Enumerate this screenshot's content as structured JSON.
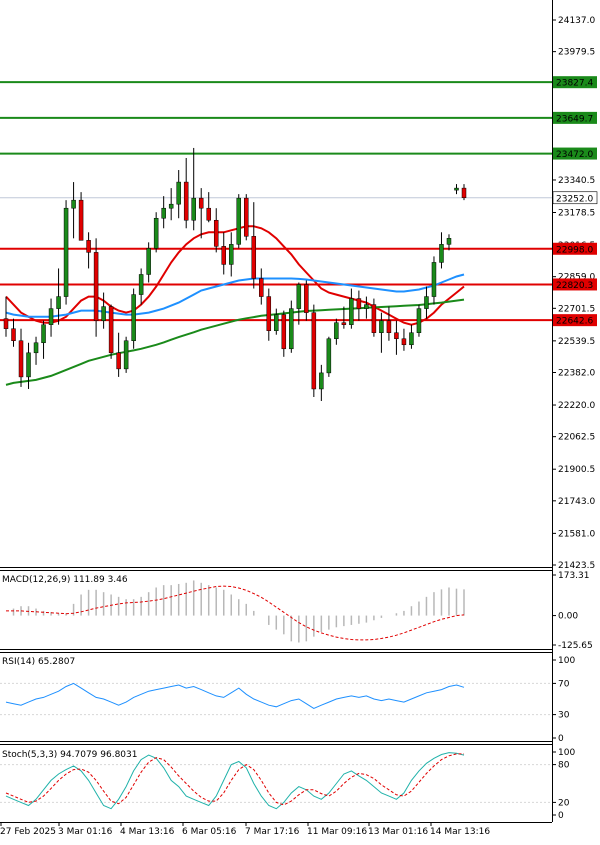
{
  "chart_data": {
    "type": "candlestick",
    "price_axis": {
      "ticks": [
        "24137.0",
        "23979.5",
        "23814.6",
        "23649.7",
        "23472.0",
        "23340.5",
        "23178.5",
        "23016.5",
        "22859.0",
        "22701.5",
        "22539.5",
        "22382.0",
        "22220.0",
        "22062.5",
        "21900.5",
        "21743.0",
        "21581.0",
        "21423.5"
      ],
      "range": [
        21423.5,
        24137.0
      ]
    },
    "time_axis": {
      "labels": [
        "27 Feb 2025",
        "3 Mar 01:16",
        "4 Mar 13:16",
        "6 Mar 05:16",
        "7 Mar 17:16",
        "11 Mar 09:16",
        "13 Mar 01:16",
        "14 Mar 13:16"
      ]
    },
    "levels": {
      "green": [
        {
          "value": 23827.4,
          "label": "23827.4"
        },
        {
          "value": 23649.7,
          "label": "23649.7"
        },
        {
          "value": 23472.0,
          "label": "23472.0"
        }
      ],
      "red": [
        {
          "value": 22998.0,
          "label": "22998.0"
        },
        {
          "value": 22820.3,
          "label": "22820.3"
        },
        {
          "value": 22642.6,
          "label": "22642.6"
        }
      ],
      "current": {
        "value": 23252.0,
        "label": "23252.0"
      }
    },
    "candles": [
      {
        "o": 22650,
        "h": 22760,
        "l": 22560,
        "c": 22600
      },
      {
        "o": 22600,
        "h": 22650,
        "l": 22510,
        "c": 22540
      },
      {
        "o": 22540,
        "h": 22600,
        "l": 22310,
        "c": 22360
      },
      {
        "o": 22360,
        "h": 22530,
        "l": 22300,
        "c": 22480
      },
      {
        "o": 22480,
        "h": 22560,
        "l": 22420,
        "c": 22530
      },
      {
        "o": 22530,
        "h": 22640,
        "l": 22450,
        "c": 22620
      },
      {
        "o": 22620,
        "h": 22750,
        "l": 22560,
        "c": 22700
      },
      {
        "o": 22700,
        "h": 22900,
        "l": 22620,
        "c": 22760
      },
      {
        "o": 22760,
        "h": 23240,
        "l": 22720,
        "c": 23200
      },
      {
        "o": 23200,
        "h": 23330,
        "l": 23050,
        "c": 23240
      },
      {
        "o": 23240,
        "h": 23280,
        "l": 23050,
        "c": 23040
      },
      {
        "o": 23040,
        "h": 23080,
        "l": 22900,
        "c": 22980
      },
      {
        "o": 22980,
        "h": 23050,
        "l": 22560,
        "c": 22640
      },
      {
        "o": 22640,
        "h": 22780,
        "l": 22600,
        "c": 22710
      },
      {
        "o": 22710,
        "h": 22720,
        "l": 22450,
        "c": 22480
      },
      {
        "o": 22480,
        "h": 22580,
        "l": 22360,
        "c": 22400
      },
      {
        "o": 22400,
        "h": 22560,
        "l": 22380,
        "c": 22540
      },
      {
        "o": 22540,
        "h": 22800,
        "l": 22500,
        "c": 22770
      },
      {
        "o": 22770,
        "h": 22900,
        "l": 22720,
        "c": 22870
      },
      {
        "o": 22870,
        "h": 23030,
        "l": 22830,
        "c": 23000
      },
      {
        "o": 23000,
        "h": 23180,
        "l": 22980,
        "c": 23150
      },
      {
        "o": 23150,
        "h": 23260,
        "l": 23100,
        "c": 23200
      },
      {
        "o": 23200,
        "h": 23300,
        "l": 23140,
        "c": 23220
      },
      {
        "o": 23220,
        "h": 23390,
        "l": 23150,
        "c": 23330
      },
      {
        "o": 23330,
        "h": 23450,
        "l": 23100,
        "c": 23140
      },
      {
        "o": 23140,
        "h": 23500,
        "l": 23090,
        "c": 23250
      },
      {
        "o": 23250,
        "h": 23300,
        "l": 23050,
        "c": 23200
      },
      {
        "o": 23200,
        "h": 23280,
        "l": 23130,
        "c": 23140
      },
      {
        "o": 23140,
        "h": 23200,
        "l": 22980,
        "c": 23010
      },
      {
        "o": 23010,
        "h": 23080,
        "l": 22870,
        "c": 22920
      },
      {
        "o": 22920,
        "h": 23080,
        "l": 22860,
        "c": 23020
      },
      {
        "o": 23020,
        "h": 23270,
        "l": 23000,
        "c": 23250
      },
      {
        "o": 23250,
        "h": 23270,
        "l": 23040,
        "c": 23060
      },
      {
        "o": 23060,
        "h": 23230,
        "l": 22800,
        "c": 22850
      },
      {
        "o": 22850,
        "h": 22900,
        "l": 22720,
        "c": 22760
      },
      {
        "o": 22760,
        "h": 22800,
        "l": 22540,
        "c": 22590
      },
      {
        "o": 22590,
        "h": 22700,
        "l": 22570,
        "c": 22670
      },
      {
        "o": 22670,
        "h": 22690,
        "l": 22460,
        "c": 22500
      },
      {
        "o": 22500,
        "h": 22740,
        "l": 22480,
        "c": 22700
      },
      {
        "o": 22700,
        "h": 22830,
        "l": 22620,
        "c": 22820
      },
      {
        "o": 22820,
        "h": 22840,
        "l": 22640,
        "c": 22680
      },
      {
        "o": 22680,
        "h": 22720,
        "l": 22260,
        "c": 22300
      },
      {
        "o": 22300,
        "h": 22420,
        "l": 22240,
        "c": 22380
      },
      {
        "o": 22380,
        "h": 22560,
        "l": 22360,
        "c": 22550
      },
      {
        "o": 22550,
        "h": 22650,
        "l": 22520,
        "c": 22630
      },
      {
        "o": 22630,
        "h": 22710,
        "l": 22600,
        "c": 22620
      },
      {
        "o": 22620,
        "h": 22800,
        "l": 22600,
        "c": 22750
      },
      {
        "o": 22750,
        "h": 22790,
        "l": 22640,
        "c": 22700
      },
      {
        "o": 22700,
        "h": 22760,
        "l": 22650,
        "c": 22720
      },
      {
        "o": 22720,
        "h": 22750,
        "l": 22560,
        "c": 22580
      },
      {
        "o": 22580,
        "h": 22680,
        "l": 22480,
        "c": 22640
      },
      {
        "o": 22640,
        "h": 22710,
        "l": 22540,
        "c": 22580
      },
      {
        "o": 22580,
        "h": 22640,
        "l": 22470,
        "c": 22550
      },
      {
        "o": 22550,
        "h": 22600,
        "l": 22490,
        "c": 22520
      },
      {
        "o": 22520,
        "h": 22620,
        "l": 22500,
        "c": 22580
      },
      {
        "o": 22580,
        "h": 22720,
        "l": 22560,
        "c": 22700
      },
      {
        "o": 22700,
        "h": 22810,
        "l": 22650,
        "c": 22760
      },
      {
        "o": 22760,
        "h": 22960,
        "l": 22720,
        "c": 22930
      },
      {
        "o": 22930,
        "h": 23080,
        "l": 22900,
        "c": 23020
      },
      {
        "o": 23020,
        "h": 23070,
        "l": 22990,
        "c": 23050
      },
      {
        "o": 23290,
        "h": 23320,
        "l": 23270,
        "c": 23300
      },
      {
        "o": 23300,
        "h": 23320,
        "l": 23240,
        "c": 23252
      }
    ],
    "moving_averages": [
      {
        "color": "#e00000",
        "values": [
          22760,
          22720,
          22680,
          22660,
          22640,
          22630,
          22630,
          22640,
          22660,
          22700,
          22740,
          22760,
          22760,
          22740,
          22710,
          22690,
          22680,
          22690,
          22720,
          22760,
          22810,
          22870,
          22930,
          22980,
          23020,
          23050,
          23070,
          23080,
          23080,
          23080,
          23090,
          23100,
          23110,
          23110,
          23100,
          23080,
          23050,
          23010,
          22970,
          22920,
          22880,
          22840,
          22800,
          22780,
          22770,
          22760,
          22750,
          22740,
          22730,
          22710,
          22690,
          22670,
          22650,
          22630,
          22620,
          22630,
          22650,
          22680,
          22720,
          22750,
          22780,
          22810
        ]
      },
      {
        "color": "#1e90ff",
        "values": [
          22680,
          22670,
          22665,
          22660,
          22660,
          22660,
          22660,
          22665,
          22670,
          22680,
          22690,
          22690,
          22690,
          22685,
          22680,
          22675,
          22670,
          22670,
          22675,
          22680,
          22690,
          22700,
          22715,
          22730,
          22750,
          22770,
          22790,
          22800,
          22810,
          22820,
          22830,
          22840,
          22845,
          22850,
          22850,
          22850,
          22850,
          22850,
          22850,
          22848,
          22845,
          22840,
          22835,
          22830,
          22825,
          22820,
          22815,
          22810,
          22805,
          22800,
          22795,
          22790,
          22785,
          22785,
          22790,
          22795,
          22805,
          22815,
          22830,
          22845,
          22860,
          22870
        ]
      },
      {
        "color": "#1a8a1a",
        "values": [
          22320,
          22330,
          22335,
          22340,
          22345,
          22355,
          22365,
          22380,
          22395,
          22410,
          22425,
          22440,
          22450,
          22460,
          22470,
          22478,
          22485,
          22492,
          22500,
          22510,
          22520,
          22532,
          22545,
          22558,
          22570,
          22582,
          22595,
          22605,
          22615,
          22625,
          22635,
          22645,
          22652,
          22658,
          22664,
          22668,
          22672,
          22676,
          22680,
          22684,
          22688,
          22690,
          22692,
          22694,
          22696,
          22698,
          22700,
          22702,
          22704,
          22706,
          22708,
          22710,
          22712,
          22714,
          22716,
          22718,
          22722,
          22726,
          22730,
          22735,
          22740,
          22745
        ]
      }
    ],
    "macd": {
      "title": "MACD(12,26,9) 111.89 3.46",
      "ticks": [
        "173.31",
        "0.00",
        "-125.65"
      ],
      "range": [
        -125.65,
        173.31
      ],
      "histogram": [
        0,
        30,
        40,
        40,
        30,
        20,
        15,
        10,
        10,
        50,
        90,
        110,
        110,
        100,
        90,
        80,
        70,
        70,
        80,
        100,
        120,
        130,
        130,
        135,
        140,
        150,
        140,
        130,
        120,
        110,
        90,
        70,
        50,
        20,
        0,
        -40,
        -60,
        -80,
        -110,
        -115,
        -110,
        -90,
        -70,
        -60,
        -50,
        -45,
        -40,
        -35,
        -30,
        -20,
        -10,
        0,
        10,
        20,
        40,
        60,
        80,
        100,
        112,
        120,
        115,
        112
      ],
      "signal": [
        20,
        20,
        20,
        18,
        16,
        14,
        12,
        10,
        8,
        10,
        16,
        24,
        32,
        38,
        44,
        50,
        54,
        56,
        58,
        62,
        66,
        72,
        80,
        88,
        96,
        104,
        112,
        118,
        124,
        126,
        124,
        118,
        108,
        94,
        78,
        58,
        36,
        14,
        -8,
        -30,
        -48,
        -62,
        -74,
        -84,
        -92,
        -98,
        -102,
        -104,
        -104,
        -102,
        -98,
        -92,
        -84,
        -74,
        -62,
        -50,
        -38,
        -26,
        -16,
        -8,
        0,
        3
      ]
    },
    "rsi": {
      "title": "RSI(14) 65.2807",
      "ticks": [
        "100",
        "70",
        "30",
        "0"
      ],
      "range": [
        0,
        100
      ],
      "values": [
        46,
        44,
        42,
        46,
        50,
        52,
        56,
        60,
        66,
        70,
        64,
        58,
        52,
        50,
        46,
        42,
        46,
        52,
        56,
        60,
        62,
        64,
        66,
        68,
        64,
        66,
        62,
        58,
        54,
        52,
        58,
        64,
        56,
        50,
        46,
        42,
        40,
        44,
        48,
        50,
        44,
        38,
        42,
        46,
        50,
        52,
        54,
        52,
        54,
        50,
        48,
        50,
        48,
        46,
        50,
        54,
        58,
        60,
        62,
        66,
        68,
        65
      ]
    },
    "stoch": {
      "title": "Stoch(5,3,3) 94.7079 96.8031",
      "ticks": [
        "100",
        "80",
        "20",
        "0"
      ],
      "range": [
        0,
        100
      ],
      "k": [
        30,
        25,
        20,
        15,
        25,
        40,
        55,
        65,
        72,
        78,
        70,
        55,
        35,
        15,
        10,
        25,
        45,
        70,
        88,
        95,
        90,
        75,
        55,
        45,
        30,
        25,
        20,
        15,
        30,
        55,
        80,
        85,
        75,
        50,
        30,
        15,
        10,
        20,
        35,
        45,
        40,
        30,
        25,
        35,
        50,
        65,
        70,
        62,
        55,
        45,
        35,
        30,
        25,
        35,
        55,
        70,
        82,
        90,
        96,
        99,
        98,
        95
      ],
      "d": [
        35,
        30,
        25,
        20,
        22,
        30,
        42,
        55,
        65,
        72,
        73,
        68,
        55,
        38,
        22,
        18,
        28,
        48,
        68,
        84,
        91,
        88,
        76,
        62,
        50,
        38,
        28,
        22,
        22,
        35,
        55,
        72,
        80,
        72,
        55,
        35,
        20,
        16,
        22,
        32,
        40,
        40,
        34,
        30,
        38,
        50,
        60,
        66,
        64,
        58,
        48,
        40,
        32,
        30,
        38,
        52,
        66,
        78,
        88,
        94,
        97,
        97
      ]
    }
  }
}
